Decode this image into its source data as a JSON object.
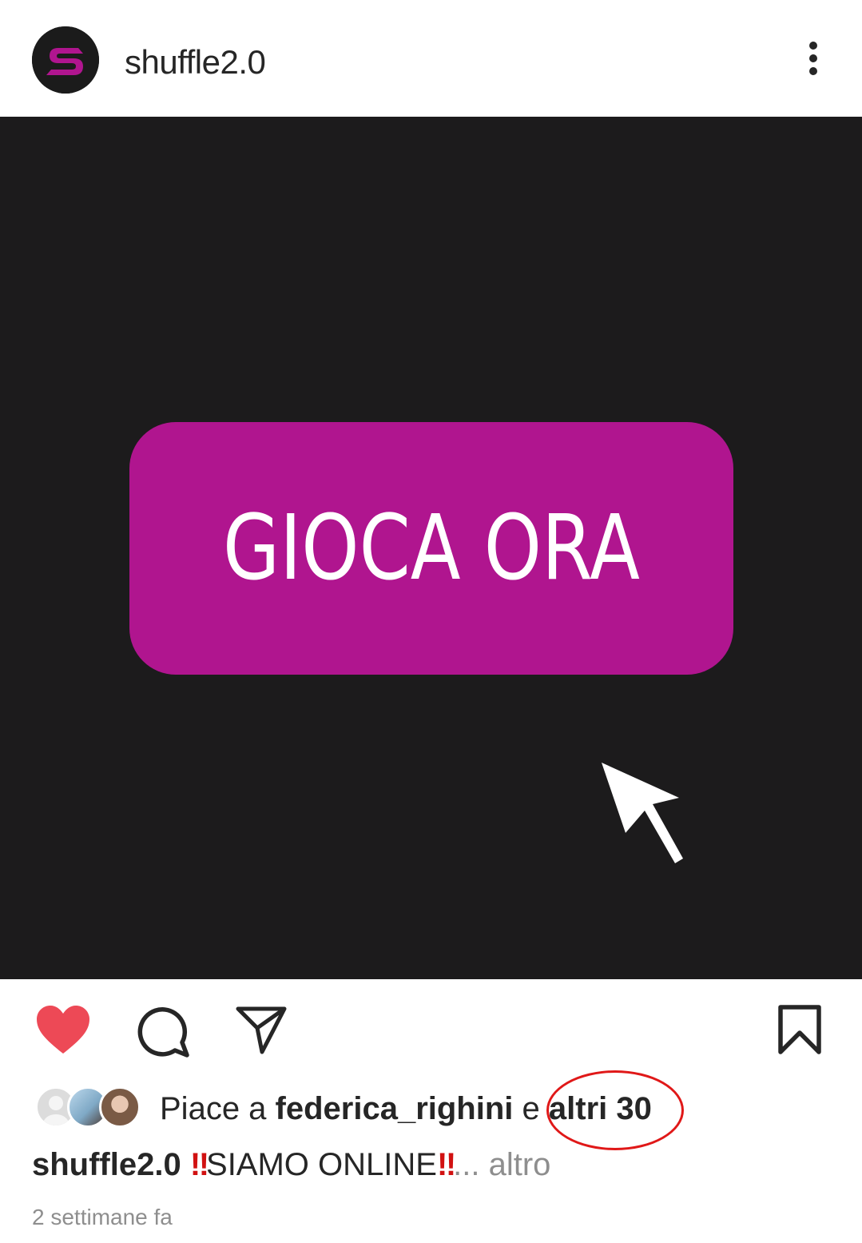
{
  "header": {
    "username": "shuffle2.0",
    "logo_letter": "S",
    "more_icon": "three-dots-vertical-icon"
  },
  "post": {
    "cta_text": "GIOCA ORA",
    "cta_color": "#b0158f",
    "background_color": "#1c1b1c"
  },
  "actions": {
    "like_icon": "heart-filled-icon",
    "comment_icon": "comment-icon",
    "share_icon": "send-icon",
    "save_icon": "bookmark-icon",
    "like_color": "#ed4956"
  },
  "likes": {
    "prefix": "Piace a ",
    "user": "federica_righini",
    "conjunction": " e ",
    "others": "altri 30"
  },
  "caption": {
    "user": "shuffle2.0",
    "bang_left": "‼",
    "text": "SIAMO ONLINE",
    "bang_right": "‼",
    "ellipsis": "... ",
    "more": "altro"
  },
  "timestamp": "2 settimane fa",
  "annotation_color": "#e01818"
}
